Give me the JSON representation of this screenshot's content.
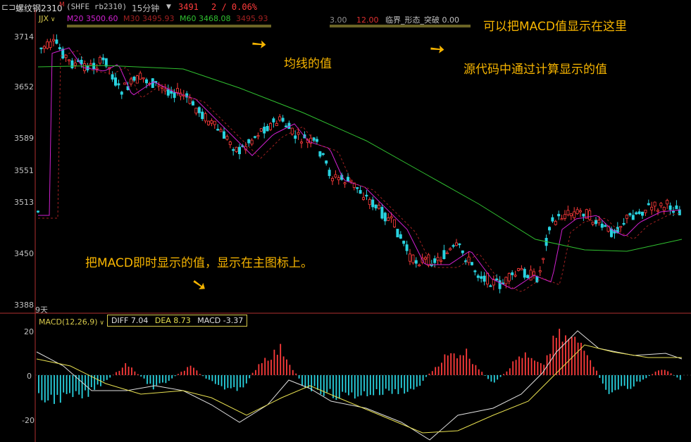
{
  "titlebar": {
    "icon": "window-icon",
    "instrument": "螺纹钢2310",
    "suffix": "M",
    "code": "(SHFE rb2310)",
    "period": "15分钟",
    "last_price": "3491",
    "change": "2 / 0.06%"
  },
  "indicator_bar": {
    "name": "JJX",
    "items": [
      {
        "label": "M20 3500.60",
        "color": "#d020d0"
      },
      {
        "label": "M30 3495.93",
        "color": "#a02020"
      },
      {
        "label": "M60 3468.08",
        "color": "#30c030"
      },
      {
        "label": "3495.93",
        "color": "#a02020"
      }
    ],
    "right_items": [
      {
        "label": "3.00",
        "color": "#909090"
      },
      {
        "label": "12.00",
        "color": "#e03030"
      },
      {
        "label": "临界_形态_突破 0.00",
        "color": "#c0c0c0"
      }
    ]
  },
  "price_axis": [
    "3714",
    "3652",
    "3589",
    "3551",
    "3513",
    "3450",
    "3388"
  ],
  "day_marker": "9天",
  "macd_panel": {
    "name": "MACD(12,26,9)",
    "diff": "DIFF 7.04",
    "dea": "DEA 8.73",
    "macd": "MACD -3.37",
    "axis": [
      "20",
      "0",
      "-20"
    ]
  },
  "annotations": {
    "ma_value": "均线的值",
    "source_value": "源代码中通过计算显示的值",
    "macd_here": "可以把MACD值显示在这里",
    "macd_main": "把MACD即时显示的值，显示在主图标上。"
  },
  "colors": {
    "up": "#ff3b3b",
    "down": "#29d3e0",
    "ma20": "#d020d0",
    "ma30": "#a02020",
    "ma60": "#30c030",
    "note": "#f7b500"
  }
}
